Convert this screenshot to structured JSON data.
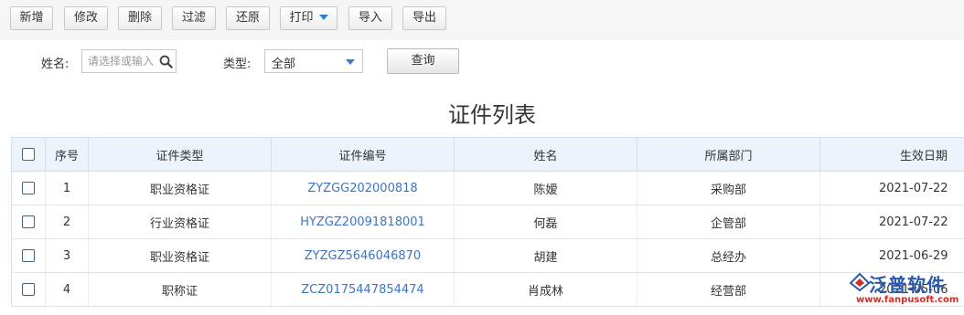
{
  "toolbar": {
    "buttons": [
      "新增",
      "修改",
      "删除",
      "过滤",
      "还原",
      "打印",
      "导入",
      "导出"
    ]
  },
  "filters": {
    "name_label": "姓名:",
    "name_placeholder": "请选择或输入",
    "type_label": "类型:",
    "type_value": "全部",
    "query_label": "查询"
  },
  "title": "证件列表",
  "table": {
    "headers": [
      "序号",
      "证件类型",
      "证件编号",
      "姓名",
      "所属部门",
      "生效日期"
    ],
    "rows": [
      {
        "no": "1",
        "type": "职业资格证",
        "code": "ZYZGG202000818",
        "name": "陈嫒",
        "dept": "采购部",
        "date": "2021-07-22"
      },
      {
        "no": "2",
        "type": "行业资格证",
        "code": "HYZGZ20091818001",
        "name": "何磊",
        "dept": "企管部",
        "date": "2021-07-22"
      },
      {
        "no": "3",
        "type": "职业资格证",
        "code": "ZYZGZ5646046870",
        "name": "胡建",
        "dept": "总经办",
        "date": "2021-06-29"
      },
      {
        "no": "4",
        "type": "职称证",
        "code": "ZCZ0175447854474",
        "name": "肖成林",
        "dept": "经营部",
        "date": "2021-05-06"
      }
    ]
  },
  "watermark": {
    "text": "泛普软件",
    "url": "www.fanpusoft.com"
  },
  "colors": {
    "link": "#3c74c3",
    "header_bg": "#ecf3fb",
    "caret": "#2f7fd1"
  }
}
